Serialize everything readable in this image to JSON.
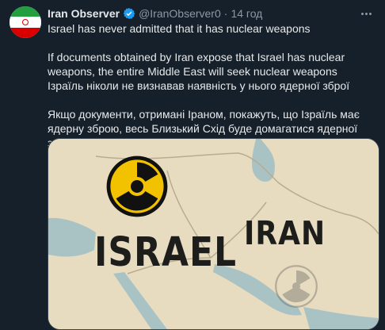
{
  "tweet": {
    "author_name": "Iran Observer",
    "handle": "@IranObserver0",
    "separator": "·",
    "time": "14 год",
    "english_line": "Israel has never admitted that it has nuclear weapons",
    "english_para": "If documents obtained by Iran expose that Israel has nuclear weapons, the entire Middle East will seek nuclear weapons",
    "ukrainian_line": "Ізраїль ніколи не визнавав наявність у нього ядерної зброї",
    "ukrainian_para": "Якщо документи, отримані Іраном, покажуть, що Ізраїль має ядерну зброю, весь Близький Схід буде домагатися ядерної зброї"
  },
  "media": {
    "label_israel": "ISRAEL",
    "label_iran": "IRAN"
  },
  "colors": {
    "background": "#15202b",
    "verified_badge": "#1d9bf0",
    "secondary_text": "#8b98a5",
    "radiation_yellow": "#f2c200"
  },
  "icons": {
    "verified": "verified-badge-icon",
    "more": "more-options-icon",
    "radiation": "radiation-icon"
  }
}
